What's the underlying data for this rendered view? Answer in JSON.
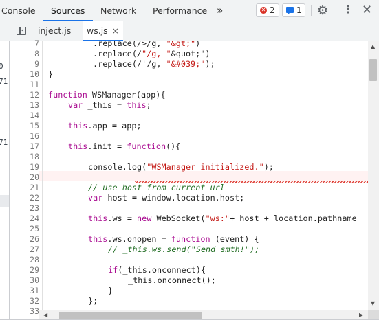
{
  "tabs": [
    {
      "label": "Console"
    },
    {
      "label": "Sources"
    },
    {
      "label": "Network"
    },
    {
      "label": "Performance"
    }
  ],
  "more_tabs_icon": "double-chevron-icon",
  "badges": {
    "errors": "2",
    "messages": "1"
  },
  "icons": {
    "settings": "gear-icon",
    "menu": "kebab-menu-icon",
    "close": "close-icon"
  },
  "file_tabs": [
    {
      "label": "inject.js"
    },
    {
      "label": "ws.js",
      "close": "×"
    }
  ],
  "left_stub_numbers": [
    "0",
    "71",
    "71"
  ],
  "line_numbers": [
    "7",
    "8",
    "9",
    "10",
    "11",
    "12",
    "13",
    "14",
    "15",
    "16",
    "17",
    "18",
    "19",
    "20",
    "21",
    "22",
    "23",
    "24",
    "25",
    "26",
    "27",
    "28",
    "29",
    "30",
    "31",
    "32",
    "33"
  ],
  "code_lines": [
    ".replace(/>/g, \"&gt;\")",
    ".replace(/\"/g, \"&quot;\")",
    ".replace(/'/g, \"&#039;\");",
    "}",
    "",
    "function WSManager(app){",
    "var _this = this;",
    "",
    "this.app = app;",
    "",
    "this.init = function(){",
    "",
    "console.log(\"WSManager initialized.\");",
    "",
    "// use host from current url",
    "var host = window.location.host;",
    "",
    "this.ws = new WebSocket(\"ws:\"+ host + location.pathname",
    "",
    "this.ws.onopen = function (event) {",
    "// _this.ws.send(\"Send smth!\");",
    "",
    "if(_this.onconnect){",
    "_this.onconnect();",
    "}",
    "};",
    ""
  ],
  "colors": {
    "accent": "#1a73e8",
    "error": "#d93025",
    "keyword": "#aa0d91",
    "string": "#c41a16",
    "comment": "#236e25"
  }
}
